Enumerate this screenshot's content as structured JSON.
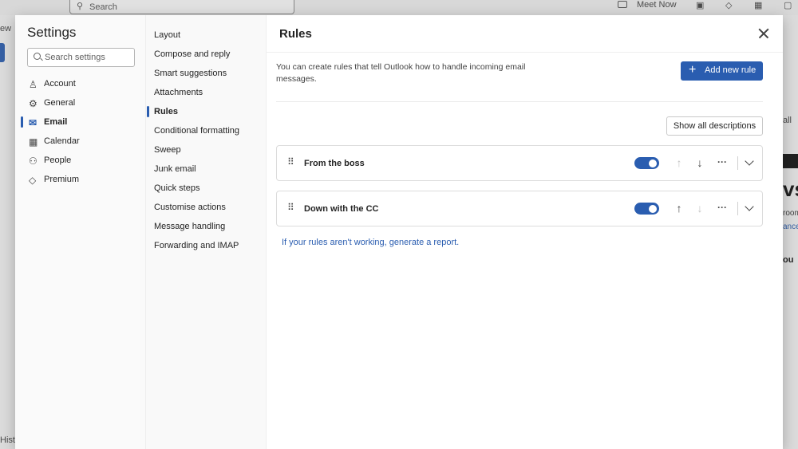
{
  "background": {
    "search_placeholder": "Search",
    "meet_now": "Meet Now",
    "left_fragment": "ew",
    "left_bottom_fragment": "Histo",
    "right_fragments": [
      "all",
      "vs",
      "room",
      "ance",
      "ou"
    ]
  },
  "settings": {
    "title": "Settings",
    "search_placeholder": "Search settings",
    "categories": [
      {
        "label": "Account",
        "icon": "person-icon"
      },
      {
        "label": "General",
        "icon": "gear-icon"
      },
      {
        "label": "Email",
        "icon": "mail-icon",
        "active": true
      },
      {
        "label": "Calendar",
        "icon": "calendar-icon"
      },
      {
        "label": "People",
        "icon": "people-icon"
      },
      {
        "label": "Premium",
        "icon": "diamond-icon"
      }
    ],
    "subcategories": [
      "Layout",
      "Compose and reply",
      "Smart suggestions",
      "Attachments",
      "Rules",
      "Conditional formatting",
      "Sweep",
      "Junk email",
      "Quick steps",
      "Customise actions",
      "Message handling",
      "Forwarding and IMAP"
    ],
    "active_subcategory": "Rules"
  },
  "rules_pane": {
    "title": "Rules",
    "description": "You can create rules that tell Outlook how to handle incoming email messages.",
    "add_button": "Add new rule",
    "show_all_button": "Show all descriptions",
    "rules": [
      {
        "name": "From the boss",
        "enabled": true,
        "up_enabled": false,
        "down_enabled": true
      },
      {
        "name": "Down with the CC",
        "enabled": true,
        "up_enabled": true,
        "down_enabled": false
      }
    ],
    "report_link": "If your rules aren't working, generate a report."
  },
  "colors": {
    "accent": "#2a5db0",
    "text": "#242424"
  }
}
